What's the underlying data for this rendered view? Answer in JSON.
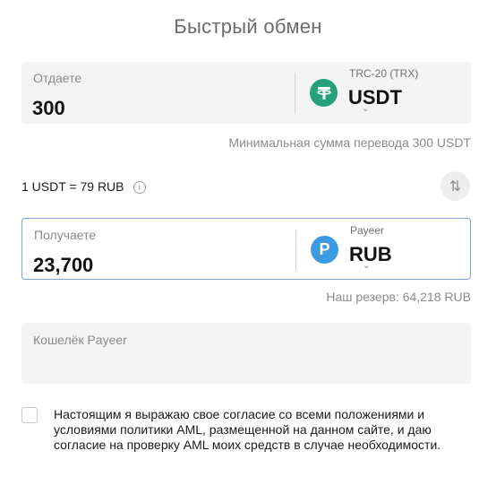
{
  "title": "Быстрый обмен",
  "give": {
    "label": "Отдаете",
    "amount": "300",
    "network": "TRC-20 (TRX)",
    "currency": "USDT",
    "icon": "tether-icon",
    "icon_color": "#26a17b"
  },
  "min_note": "Минимальная сумма перевода 300 USDT",
  "rate": "1 USDT = 79 RUB",
  "receive": {
    "label": "Получаете",
    "amount": "23,700",
    "network": "Payeer",
    "currency": "RUB",
    "icon": "payeer-icon",
    "icon_color": "#3b9ae1"
  },
  "reserve_note": "Наш резерв: 64,218 RUB",
  "wallet": {
    "placeholder": "Кошелёк Payeer"
  },
  "consent": "Настоящим я выражаю свое согласие со всеми положениями и условиями политики AML, размещенной на данном сайте, и даю согласие на проверку AML моих средств в случае необходимости."
}
